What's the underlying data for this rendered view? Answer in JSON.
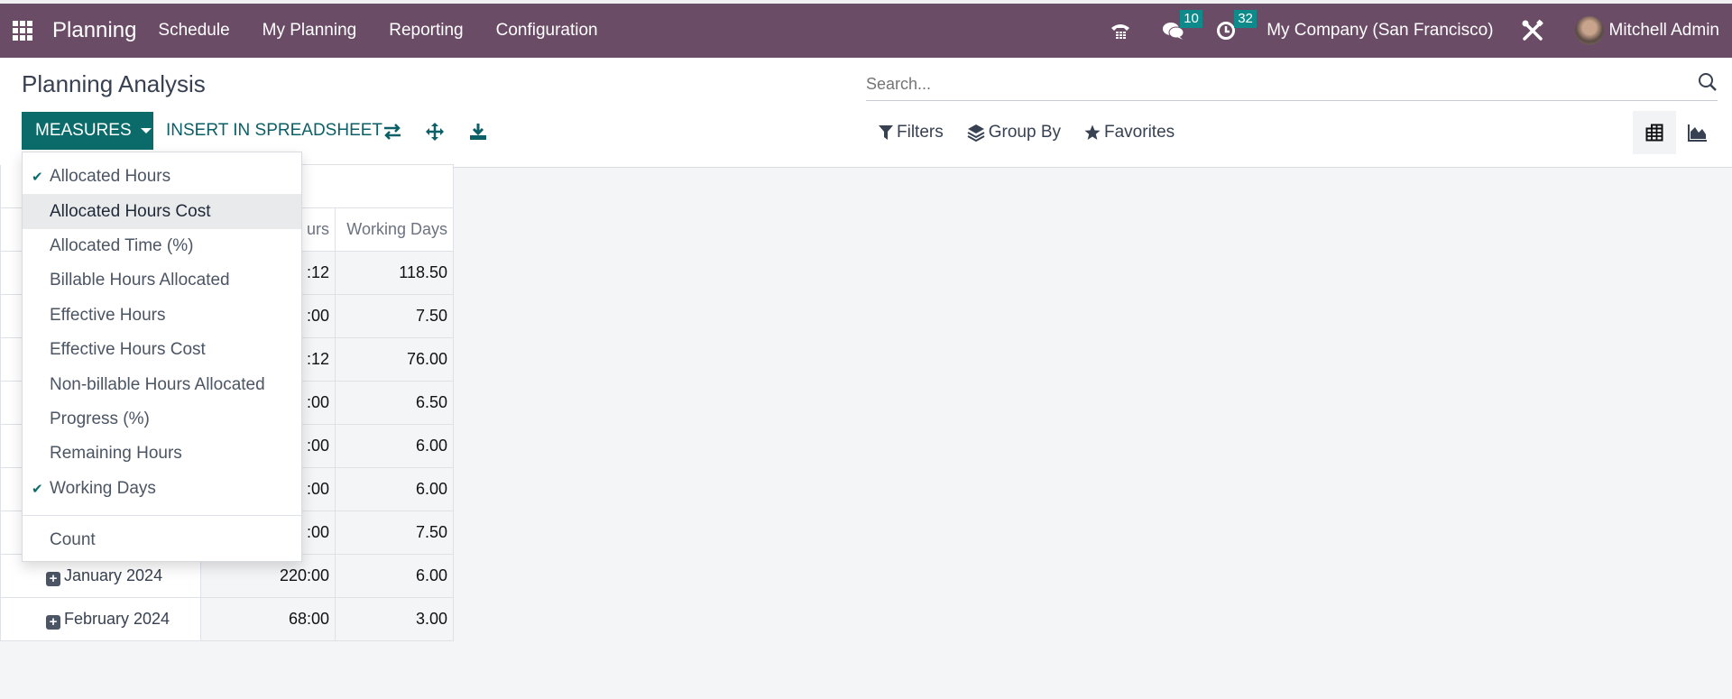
{
  "navbar": {
    "app_name": "Planning",
    "menus": [
      "Schedule",
      "My Planning",
      "Reporting",
      "Configuration"
    ],
    "messages_badge": "10",
    "activities_badge": "32",
    "company": "My Company (San Francisco)",
    "user": "Mitchell Admin",
    "accent_color": "#6b4c66"
  },
  "control": {
    "title": "Planning Analysis",
    "measures_label": "MEASURES",
    "insert_spreadsheet_label": "INSERT IN SPREADSHEET",
    "search_placeholder": "Search...",
    "filters_label": "Filters",
    "groupby_label": "Group By",
    "favorites_label": "Favorites",
    "primary_color": "#0b6b6b"
  },
  "measures_menu": {
    "items": [
      {
        "label": "Allocated Hours",
        "checked": true
      },
      {
        "label": "Allocated Hours Cost",
        "checked": false,
        "hovered": true
      },
      {
        "label": "Allocated Time (%)",
        "checked": false
      },
      {
        "label": "Billable Hours Allocated",
        "checked": false
      },
      {
        "label": "Effective Hours",
        "checked": false
      },
      {
        "label": "Effective Hours Cost",
        "checked": false
      },
      {
        "label": "Non-billable Hours Allocated",
        "checked": false
      },
      {
        "label": "Progress (%)",
        "checked": false
      },
      {
        "label": "Remaining Hours",
        "checked": false
      },
      {
        "label": "Working Days",
        "checked": true
      }
    ],
    "count_label": "Count"
  },
  "pivot": {
    "headers": {
      "allocated_hours_partial": "urs",
      "working_days": "Working Days"
    },
    "rows": [
      {
        "label": "",
        "allocated_hours": ":12",
        "working_days": "118.50"
      },
      {
        "label": "",
        "allocated_hours": ":00",
        "working_days": "7.50"
      },
      {
        "label": "",
        "allocated_hours": ":12",
        "working_days": "76.00"
      },
      {
        "label": "",
        "allocated_hours": ":00",
        "working_days": "6.50"
      },
      {
        "label": "",
        "allocated_hours": ":00",
        "working_days": "6.00"
      },
      {
        "label": "",
        "allocated_hours": ":00",
        "working_days": "6.00"
      },
      {
        "label": "",
        "allocated_hours": ":00",
        "working_days": "7.50"
      },
      {
        "label": "January 2024",
        "allocated_hours": "220:00",
        "working_days": "6.00"
      },
      {
        "label": "February 2024",
        "allocated_hours": "68:00",
        "working_days": "3.00"
      }
    ]
  }
}
